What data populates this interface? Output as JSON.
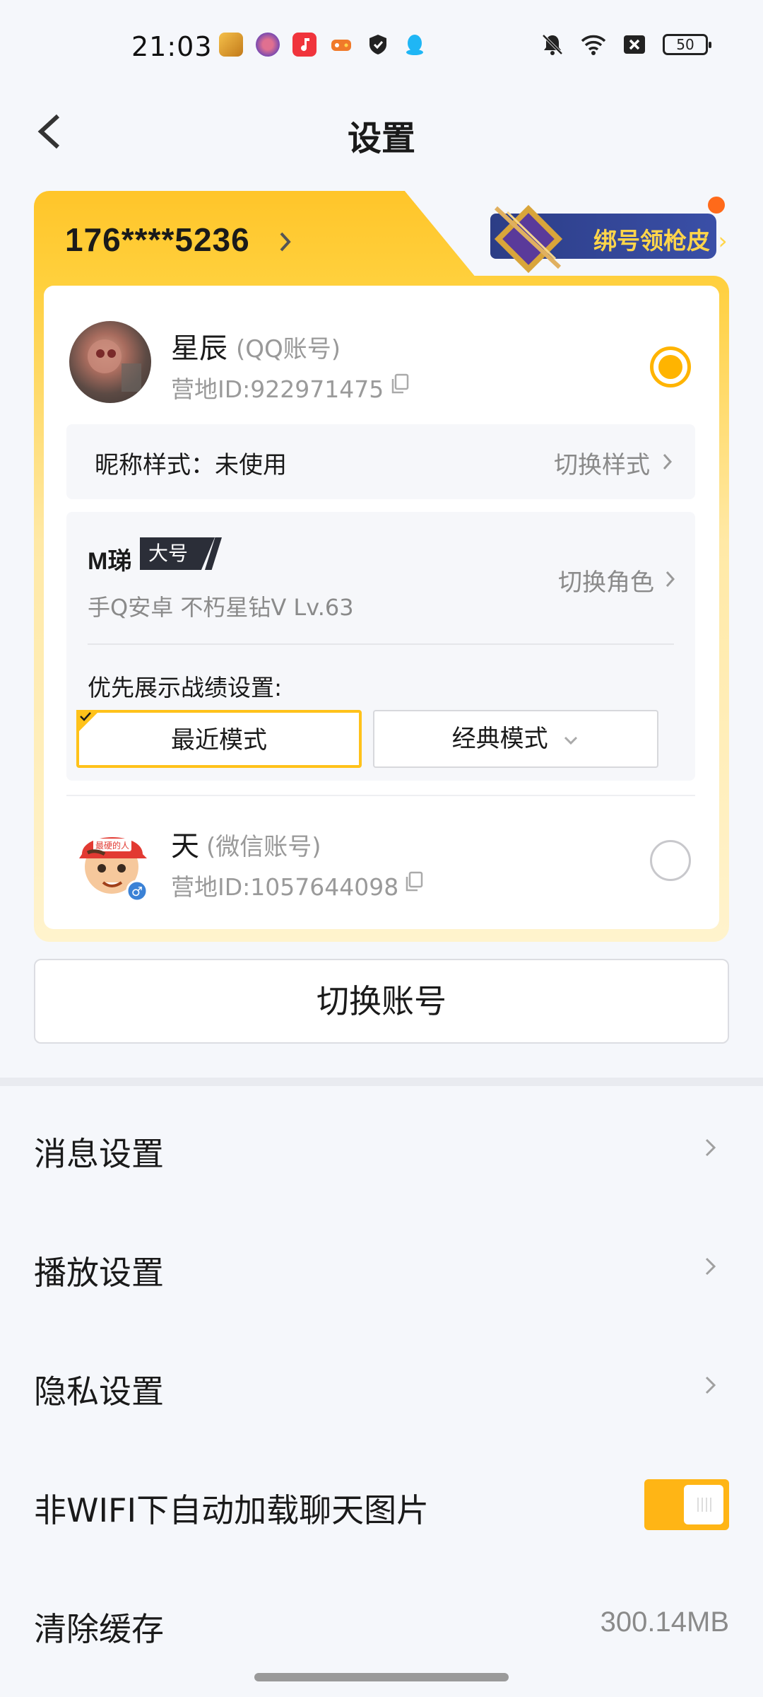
{
  "status_bar": {
    "time": "21:03",
    "battery": "50",
    "app_icons": [
      {
        "name": "game-app-icon",
        "color": "#e8a33a"
      },
      {
        "name": "flower-app-icon",
        "color": "#c0506a"
      },
      {
        "name": "music-app-icon",
        "color": "#f0343c"
      },
      {
        "name": "game-controller-app-icon",
        "color": "#f07a2a"
      },
      {
        "name": "shield-app-icon",
        "color": "#222222"
      },
      {
        "name": "qq-app-icon",
        "color": "#1fb6f5"
      }
    ]
  },
  "header": {
    "title": "设置"
  },
  "account_card": {
    "phone": "176****5236",
    "promo_label": "绑号领枪皮",
    "accounts": [
      {
        "name": "星辰",
        "type": "(QQ账号)",
        "camp_id": "营地ID:922971475",
        "selected": true
      },
      {
        "name": "天",
        "type": "(微信账号)",
        "camp_id": "营地ID:1057644098",
        "selected": false
      }
    ],
    "nickname_style": {
      "label": "昵称样式：未使用",
      "action": "切换样式"
    },
    "role": {
      "name": "M珶",
      "badge": "大号",
      "meta": "手Q安卓  不朽星钻V  Lv.63",
      "action": "切换角色"
    },
    "record_pref": {
      "label": "优先展示战绩设置:",
      "modes": [
        "最近模式",
        "经典模式"
      ],
      "selected": "最近模式"
    }
  },
  "switch_account_label": "切换账号",
  "settings": [
    {
      "label": "消息设置"
    },
    {
      "label": "播放设置"
    },
    {
      "label": "隐私设置"
    },
    {
      "label": "非WIFI下自动加载聊天图片",
      "toggle_on": true
    },
    {
      "label": "清除缓存",
      "value": "300.14MB"
    }
  ],
  "colors": {
    "accent": "#ffb515",
    "card_gold": "#ffc52a",
    "promo_bg": "#2c3d86",
    "promo_text": "#ffd54a"
  }
}
